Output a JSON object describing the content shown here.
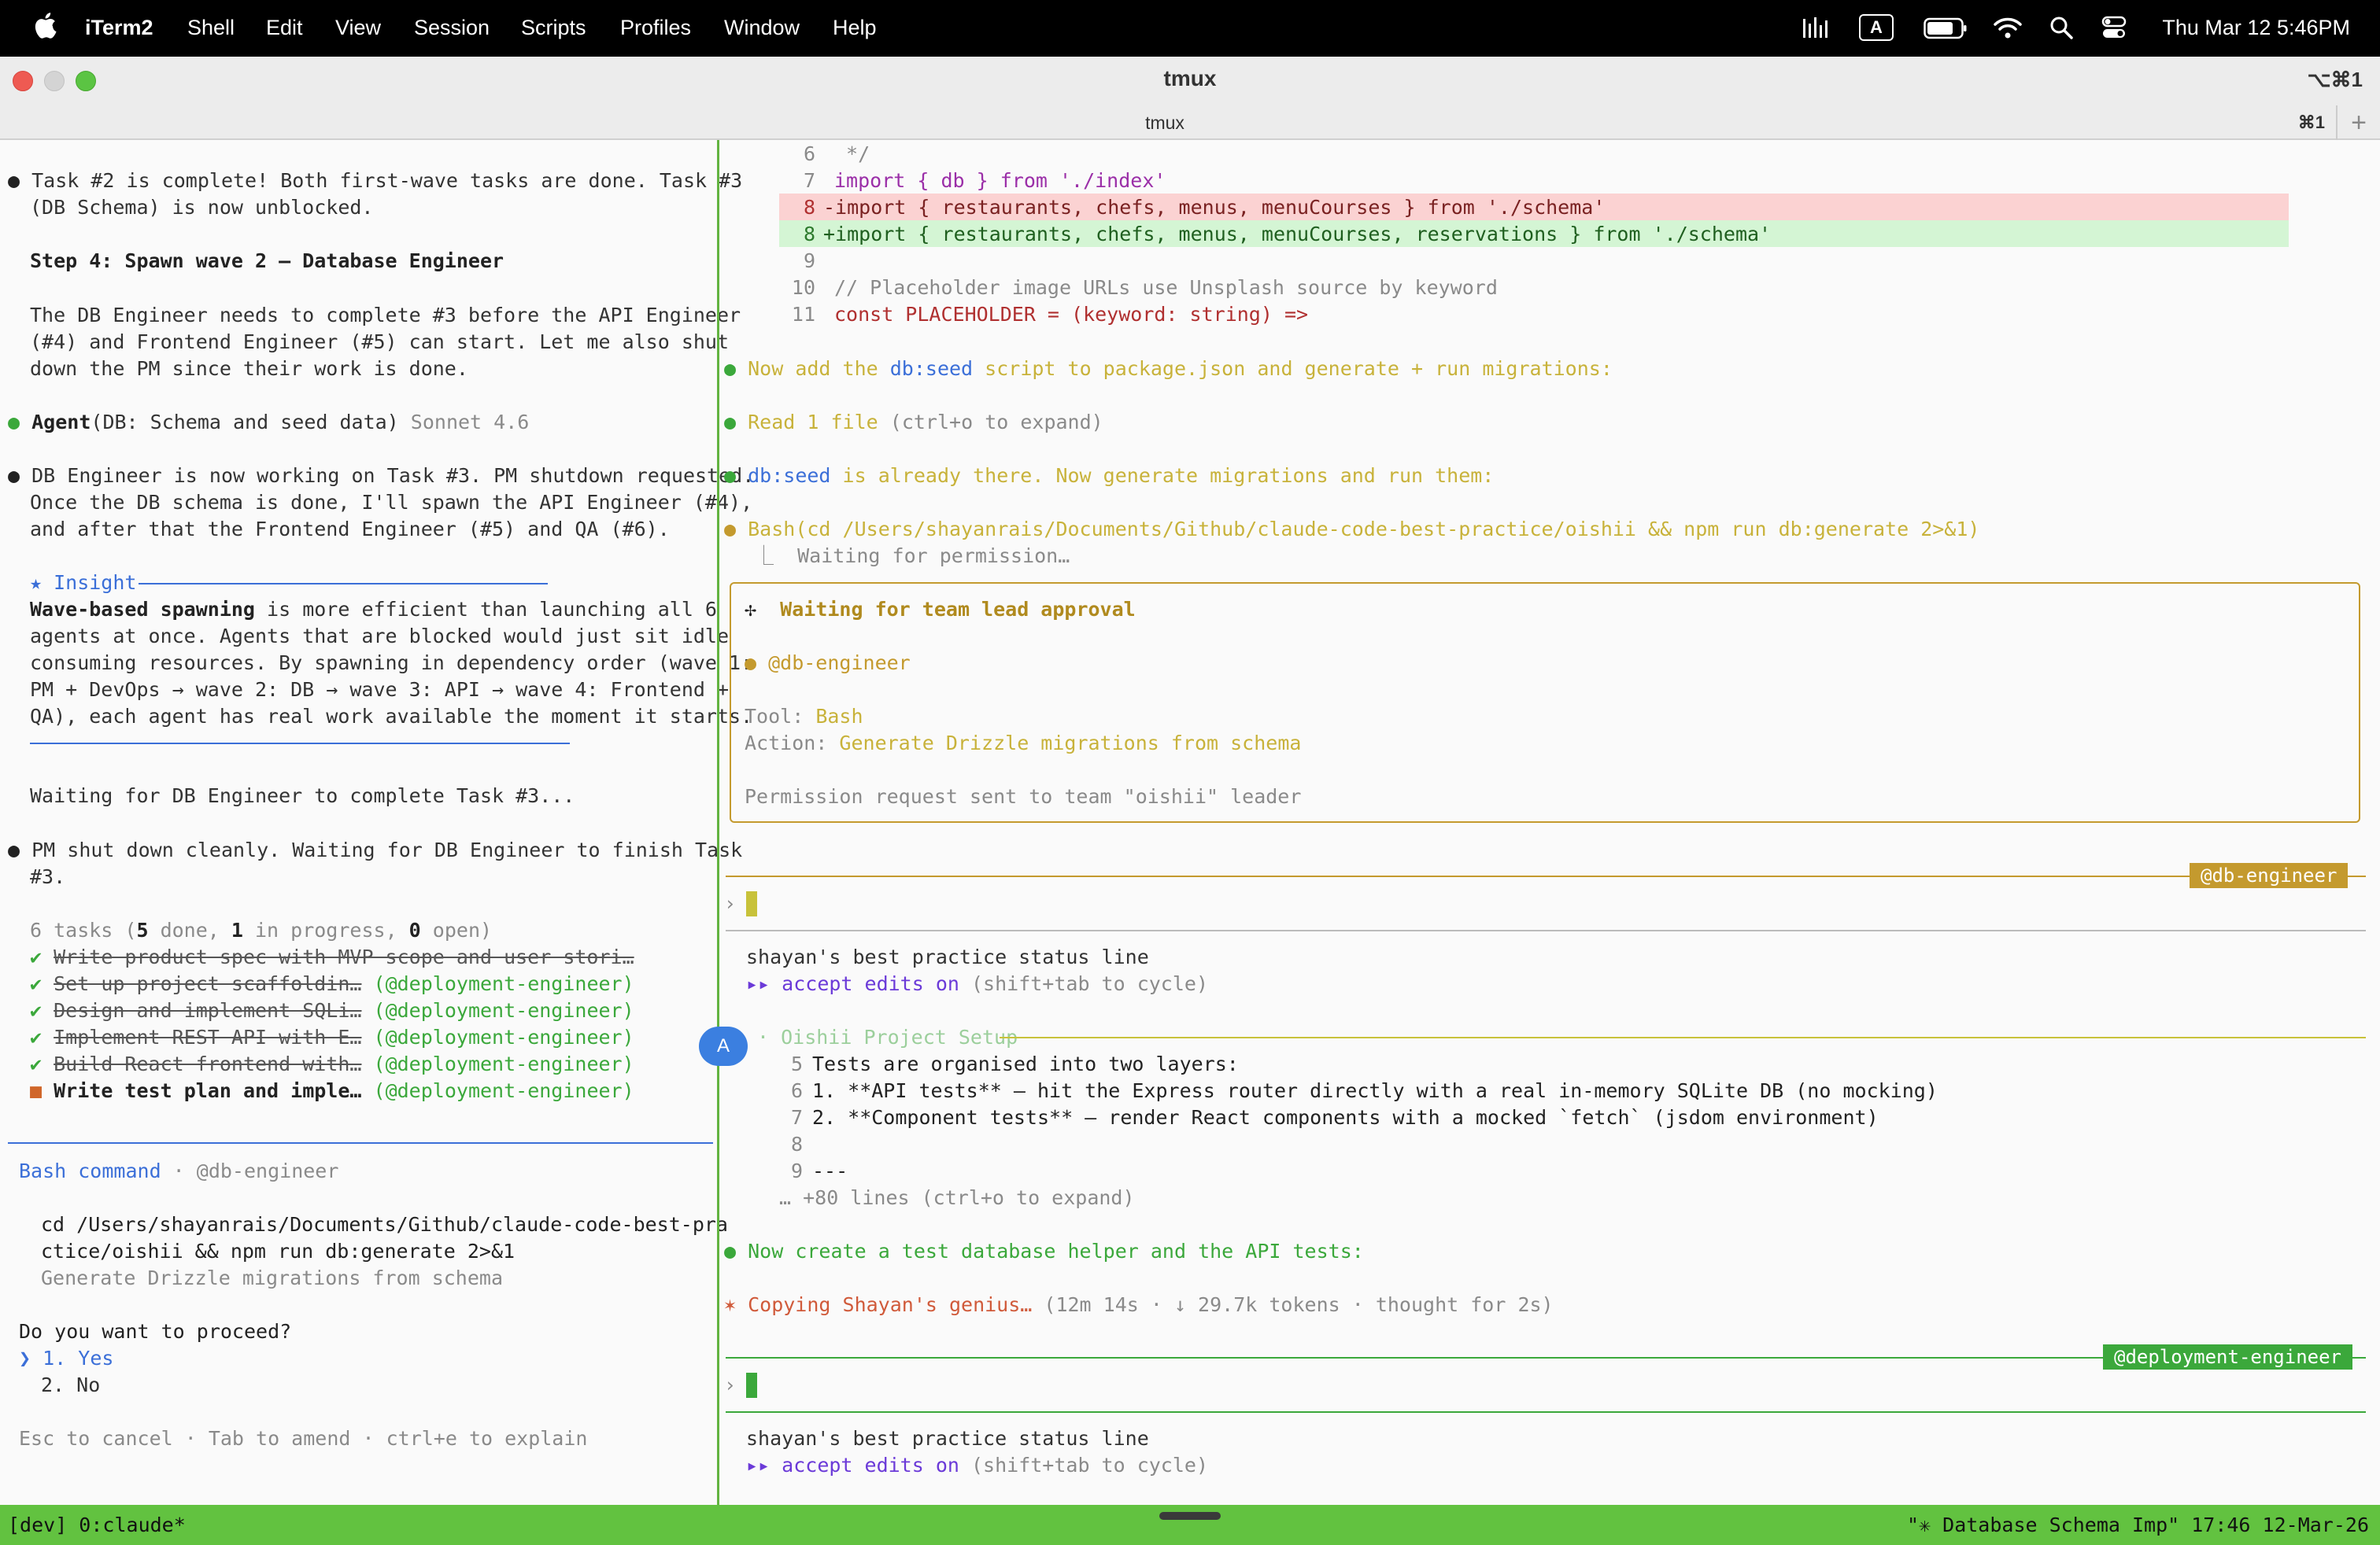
{
  "menubar": {
    "apple_icon": "apple-icon",
    "items": [
      "iTerm2",
      "Shell",
      "Edit",
      "View",
      "Session",
      "Scripts",
      "Profiles",
      "Window",
      "Help"
    ],
    "clock": "Thu Mar 12  5:46PM",
    "status_icons": [
      "audio-bars-icon",
      "keyboard-input-icon",
      "battery-icon",
      "wifi-icon",
      "spotlight-search-icon",
      "control-center-icon"
    ],
    "input_letter": "A"
  },
  "window": {
    "title": "tmux",
    "shortcut": "⌥⌘1",
    "tab_label": "tmux",
    "tab_shortcut": "⌘1",
    "new_tab": "+"
  },
  "left": {
    "l1": "Task #2 is complete! Both first-wave tasks are done. Task #3",
    "l2": "(DB Schema) is now unblocked.",
    "step": "Step 4: Spawn wave 2 – Database Engineer",
    "p1": "The DB Engineer needs to complete #3 before the API Engineer",
    "p2": "(#4) and Frontend Engineer (#5) can start. Let me also shut",
    "p3": "down the PM since their work is done.",
    "agent_name": "Agent",
    "agent_args": "(DB: Schema and seed data)",
    "agent_model": "Sonnet 4.6",
    "d1": "DB Engineer is now working on Task #3. PM shutdown requested.",
    "d2": "Once the DB schema is done, I'll spawn the API Engineer (#4),",
    "d3": "and after that the Frontend Engineer (#5) and QA (#6).",
    "insight_label": "★ Insight",
    "ins1_bold": "Wave-based spawning",
    "ins1_rest": " is more efficient than launching all 6",
    "ins2": "agents at once. Agents that are blocked would just sit idle",
    "ins3": "consuming resources. By spawning in dependency order (wave 1:",
    "ins4": "PM + DevOps → wave 2: DB → wave 3: API → wave 4: Frontend +",
    "ins5": "QA), each agent has real work available the moment it starts.",
    "waiting": "Waiting for DB Engineer to complete Task #3...",
    "pm1": "PM shut down cleanly. Waiting for DB Engineer to finish Task",
    "pm2": "#3.",
    "tasks_head_pre": "6 tasks (",
    "tasks_done_n": "5",
    "tasks_done_t": " done, ",
    "tasks_prog_n": "1",
    "tasks_prog_t": " in progress, ",
    "tasks_open_n": "0",
    "tasks_open_t": " open)",
    "tasks": [
      {
        "mark": "✔",
        "text": "Write product spec with MVP scope and user stori…",
        "owner": "",
        "done": true
      },
      {
        "mark": "✔",
        "text": "Set up project scaffoldin…",
        "owner": "(@deployment-engineer)",
        "done": true
      },
      {
        "mark": "✔",
        "text": "Design and implement SQLi…",
        "owner": "(@deployment-engineer)",
        "done": true
      },
      {
        "mark": "✔",
        "text": "Implement REST API with E…",
        "owner": "(@deployment-engineer)",
        "done": true
      },
      {
        "mark": "✔",
        "text": "Build React frontend with…",
        "owner": "(@deployment-engineer)",
        "done": true
      },
      {
        "mark": "■",
        "text": "Write test plan and imple…",
        "owner": "(@deployment-engineer)",
        "done": false
      }
    ],
    "bash_title": "Bash command",
    "bash_sep": " · ",
    "bash_agent": "@db-engineer",
    "cmd1": "cd /Users/shayanrais/Documents/Github/claude-code-best-pra",
    "cmd2": "ctice/oishii && npm run db:generate 2>&1",
    "cmd_desc": "Generate Drizzle migrations from schema",
    "question": "Do you want to proceed?",
    "opt_pointer": "❯",
    "opt1": "1. Yes",
    "opt2": "2. No",
    "footer": "Esc to cancel · Tab to amend · ctrl+e to explain"
  },
  "right": {
    "code": [
      {
        "n": "6",
        "t": " */"
      },
      {
        "n": "7",
        "t": "import { db } from './index'"
      },
      {
        "n": "8",
        "t": "-import { restaurants, chefs, menus, menuCourses } from './schema'"
      },
      {
        "n": "8",
        "t": "+import { restaurants, chefs, menus, menuCourses, reservations } from './schema'"
      },
      {
        "n": "9",
        "t": ""
      },
      {
        "n": "10",
        "t": "// Placeholder image URLs use Unsplash source by keyword"
      },
      {
        "n": "11",
        "t": "const PLACEHOLDER = (keyword: string) =>"
      }
    ],
    "m1_pre": "Now add the ",
    "m1_code": "db:seed",
    "m1_post": " script to package.json and generate + run migrations:",
    "read": "Read",
    "read_n": "1 file",
    "read_hint": "(ctrl+o to expand)",
    "m2_code": "db:seed",
    "m2_post": " is already there. Now generate migrations and run them:",
    "bash": "Bash(cd /Users/shayanrais/Documents/Github/claude-code-best-practice/oishii && npm run db:generate 2>&1)",
    "bash_wait": "⎿  Waiting for permission…",
    "approval_icon": "✢",
    "approval_title": "Waiting for team lead approval",
    "approval_agent": "● @db-engineer",
    "tool_label": "Tool: ",
    "tool_value": "Bash",
    "action_label": "Action: ",
    "action_value": "Generate Drizzle migrations from schema",
    "permission": "Permission request sent to team \"oishii\" leader",
    "tag1": "@db-engineer",
    "prompt": "›",
    "status1": "shayan's best practice status line",
    "accept_arrows": "▸▸",
    "accept": " accept edits on",
    "accept_hint": " (shift+tab to cycle)",
    "avatar": "A",
    "oishii": "· Oishii Project Setup",
    "file": [
      {
        "n": "5",
        "t": "Tests are organised into two layers:"
      },
      {
        "n": "6",
        "t": "1. **API tests** – hit the Express router directly with a real in-memory SQLite DB (no mocking)"
      },
      {
        "n": "7",
        "t": "2. **Component tests** – render React components with a mocked `fetch` (jsdom environment)"
      },
      {
        "n": "8",
        "t": ""
      },
      {
        "n": "9",
        "t": "---"
      }
    ],
    "more": "… +80 lines (ctrl+o to expand)",
    "m3": "Now create a test database helper and the API tests:",
    "copy": "✶ Copying Shayan's genius…",
    "copy_stats": " (12m 14s · ↓ 29.7k tokens · thought for 2s)",
    "tag2": "@deployment-engineer",
    "status2": "shayan's best practice status line"
  },
  "statusbar": {
    "left": "[dev] 0:claude*",
    "right": "\"✳ Database Schema Imp\" 17:46 12-Mar-26"
  },
  "colors": {
    "green": "#62c240",
    "amber": "#c49a2e",
    "blue": "#3b7fe0",
    "menubar": "#000000"
  }
}
